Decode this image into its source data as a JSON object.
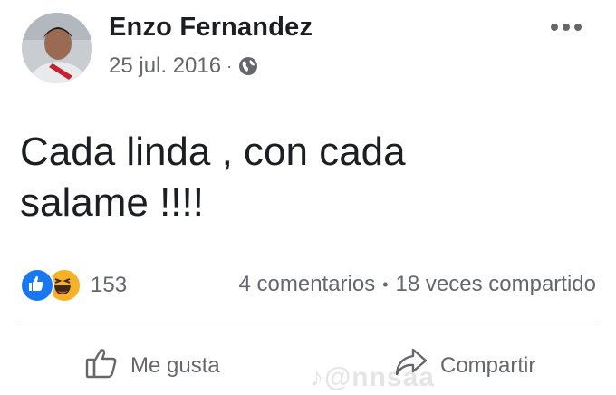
{
  "post": {
    "author": "Enzo Fernandez",
    "date": "25 jul. 2016",
    "meta_separator": "·",
    "privacy_icon": "globe-icon",
    "text": "Cada linda , con cada\nsalame !!!!"
  },
  "stats": {
    "reaction_icons": [
      "like-reaction-icon",
      "haha-reaction-icon"
    ],
    "reaction_count": "153",
    "comments": "4 comentarios",
    "separator": "•",
    "shares": "18 veces compartido"
  },
  "actions": {
    "like_label": "Me gusta",
    "share_label": "Compartir"
  },
  "watermark": "♪@nnsaa",
  "colors": {
    "like_blue": "#1877f2",
    "haha_yellow": "#f7b125",
    "secondary_text": "#65676b"
  }
}
